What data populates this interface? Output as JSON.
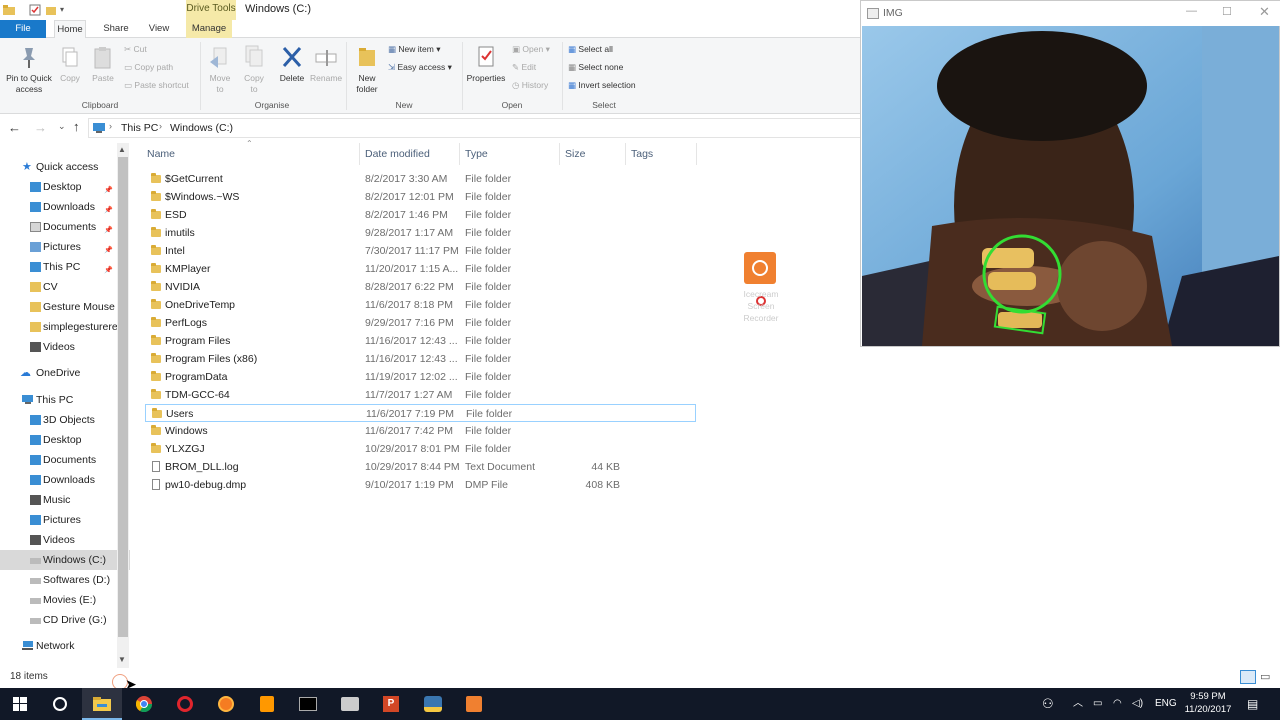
{
  "window": {
    "drive_tools": "Drive Tools",
    "title": "Windows (C:)"
  },
  "tabs": [
    "File",
    "Home",
    "Share",
    "View",
    "Manage"
  ],
  "ribbon": {
    "clipboard": {
      "pin": "Pin to Quick access",
      "copy": "Copy",
      "paste": "Paste",
      "cut": "Cut",
      "copy_path": "Copy path",
      "paste_shortcut": "Paste shortcut",
      "label": "Clipboard"
    },
    "organise": {
      "move_to": "Move to",
      "copy_to": "Copy to",
      "delete": "Delete",
      "rename": "Rename",
      "label": "Organise"
    },
    "new": {
      "new_folder": "New folder",
      "new_item": "New item",
      "easy_access": "Easy access",
      "label": "New"
    },
    "open": {
      "properties": "Properties",
      "open": "Open",
      "edit": "Edit",
      "history": "History",
      "label": "Open"
    },
    "select": {
      "select_all": "Select all",
      "select_none": "Select none",
      "invert": "Invert selection",
      "label": "Select"
    }
  },
  "address": {
    "crumbs": [
      "This PC",
      "Windows (C:)"
    ]
  },
  "nav": {
    "quick_access": "Quick access",
    "quick_items": [
      "Desktop",
      "Downloads",
      "Documents",
      "Pictures",
      "This PC",
      "CV",
      "Gesture Mouse",
      "simplegesturerec",
      "Videos"
    ],
    "onedrive": "OneDrive",
    "this_pc": "This PC",
    "pc_items": [
      "3D Objects",
      "Desktop",
      "Documents",
      "Downloads",
      "Music",
      "Pictures",
      "Videos",
      "Windows (C:)",
      "Softwares (D:)",
      "Movies (E:)",
      "CD Drive (G:)"
    ],
    "network": "Network"
  },
  "columns": {
    "name": "Name",
    "date": "Date modified",
    "type": "Type",
    "size": "Size",
    "tags": "Tags"
  },
  "files": [
    {
      "name": "$GetCurrent",
      "date": "8/2/2017 3:30 AM",
      "type": "File folder",
      "size": "",
      "kind": "folder"
    },
    {
      "name": "$Windows.~WS",
      "date": "8/2/2017 12:01 PM",
      "type": "File folder",
      "size": "",
      "kind": "folder"
    },
    {
      "name": "ESD",
      "date": "8/2/2017 1:46 PM",
      "type": "File folder",
      "size": "",
      "kind": "folder"
    },
    {
      "name": "imutils",
      "date": "9/28/2017 1:17 AM",
      "type": "File folder",
      "size": "",
      "kind": "folder"
    },
    {
      "name": "Intel",
      "date": "7/30/2017 11:17 PM",
      "type": "File folder",
      "size": "",
      "kind": "folder"
    },
    {
      "name": "KMPlayer",
      "date": "11/20/2017 1:15 A...",
      "type": "File folder",
      "size": "",
      "kind": "folder"
    },
    {
      "name": "NVIDIA",
      "date": "8/28/2017 6:22 PM",
      "type": "File folder",
      "size": "",
      "kind": "folder"
    },
    {
      "name": "OneDriveTemp",
      "date": "11/6/2017 8:18 PM",
      "type": "File folder",
      "size": "",
      "kind": "folder"
    },
    {
      "name": "PerfLogs",
      "date": "9/29/2017 7:16 PM",
      "type": "File folder",
      "size": "",
      "kind": "folder"
    },
    {
      "name": "Program Files",
      "date": "11/16/2017 12:43 ...",
      "type": "File folder",
      "size": "",
      "kind": "folder"
    },
    {
      "name": "Program Files (x86)",
      "date": "11/16/2017 12:43 ...",
      "type": "File folder",
      "size": "",
      "kind": "folder"
    },
    {
      "name": "ProgramData",
      "date": "11/19/2017 12:02 ...",
      "type": "File folder",
      "size": "",
      "kind": "folder"
    },
    {
      "name": "TDM-GCC-64",
      "date": "11/7/2017 1:27 AM",
      "type": "File folder",
      "size": "",
      "kind": "folder"
    },
    {
      "name": "Users",
      "date": "11/6/2017 7:19 PM",
      "type": "File folder",
      "size": "",
      "kind": "folder"
    },
    {
      "name": "Windows",
      "date": "11/6/2017 7:42 PM",
      "type": "File folder",
      "size": "",
      "kind": "folder"
    },
    {
      "name": "YLXZGJ",
      "date": "10/29/2017 8:01 PM",
      "type": "File folder",
      "size": "",
      "kind": "folder"
    },
    {
      "name": "BROM_DLL.log",
      "date": "10/29/2017 8:44 PM",
      "type": "Text Document",
      "size": "44 KB",
      "kind": "doc"
    },
    {
      "name": "pw10-debug.dmp",
      "date": "9/10/2017 1:19 PM",
      "type": "DMP File",
      "size": "408 KB",
      "kind": "doc"
    }
  ],
  "status": {
    "count": "18 items"
  },
  "img_window": {
    "title": "IMG"
  },
  "desktop_icon": {
    "label": "Icecream Screen Recorder"
  },
  "taskbar": {
    "lang": "ENG",
    "time": "9:59 PM",
    "date": "11/20/2017"
  },
  "colors": {
    "accent": "#1979ca",
    "selection_border": "#99d1ff",
    "taskbar": "#111827",
    "drive_tools": "#f5e9a8"
  }
}
